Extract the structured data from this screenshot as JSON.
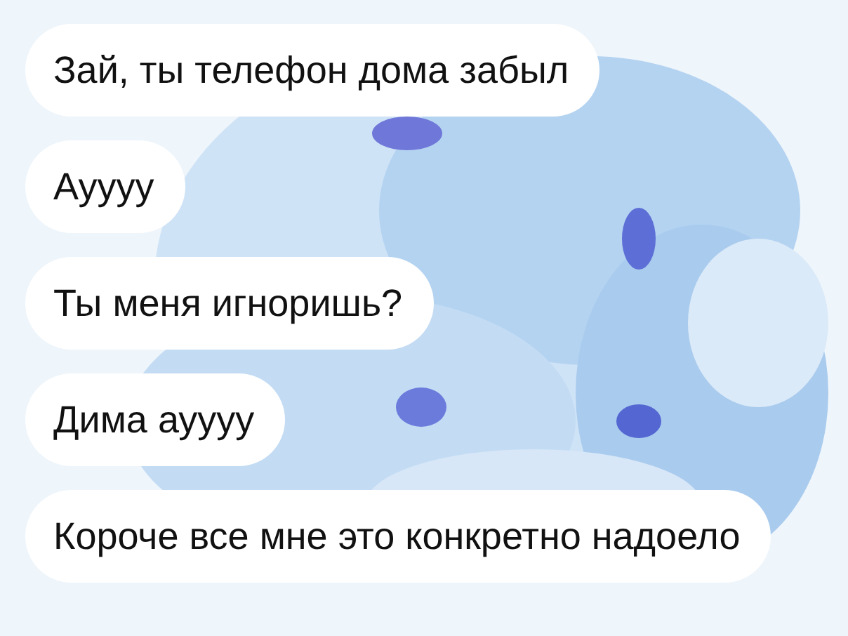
{
  "messages": [
    {
      "text": "Зай, ты телефон дома забыл"
    },
    {
      "text": "Ауууу"
    },
    {
      "text": "Ты меня игноришь?"
    },
    {
      "text": "Дима ауууу"
    },
    {
      "text": "Короче все мне это конкретно надоело"
    }
  ]
}
